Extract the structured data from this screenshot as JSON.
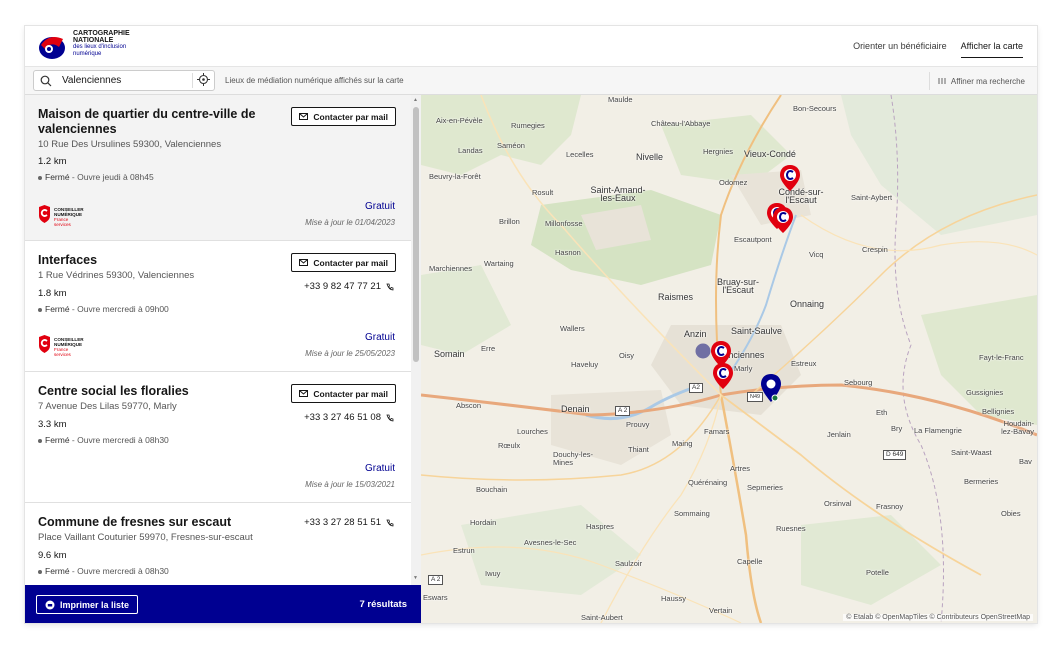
{
  "header": {
    "brand_line1": "CARTOGRAPHIE",
    "brand_line2": "NATIONALE",
    "brand_line3": "des lieux d'inclusion",
    "brand_line4": "numérique",
    "nav_orient": "Orienter un bénéficiaire",
    "nav_map": "Afficher la carte"
  },
  "search": {
    "value": "Valenciennes",
    "caption": "Lieux de médiation numérique affichés sur la carte",
    "refine_label": "Affiner ma recherche"
  },
  "cards": [
    {
      "title": "Maison de quartier du centre-ville de valenciennes",
      "address": "10 Rue Des Ursulines 59300, Valenciennes",
      "distance": "1.2 km",
      "status_closed": "Fermé",
      "status_detail": " - Ouvre jeudi à 08h45",
      "mail_label": "Contacter par mail",
      "price": "Gratuit",
      "updated": "Mise à jour le 01/04/2023"
    },
    {
      "title": "Interfaces",
      "address": "1 Rue Védrines 59300, Valenciennes",
      "distance": "1.8 km",
      "status_closed": "Fermé",
      "status_detail": " - Ouvre mercredi à 09h00",
      "mail_label": "Contacter par mail",
      "phone": "+33 9 82 47 77 21",
      "price": "Gratuit",
      "updated": "Mise à jour le 25/05/2023"
    },
    {
      "title": "Centre social les floralies",
      "address": "7 Avenue Des Lilas 59770, Marly",
      "distance": "3.3 km",
      "status_closed": "Fermé",
      "status_detail": " - Ouvre mercredi à 08h30",
      "mail_label": "Contacter par mail",
      "phone": "+33 3 27 46 51 08",
      "price": "Gratuit",
      "updated": "Mise à jour le 15/03/2021"
    },
    {
      "title": "Commune de fresnes sur escaut",
      "address": "Place Vaillant Couturier 59970, Fresnes-sur-escaut",
      "distance": "9.6 km",
      "status_closed": "Fermé",
      "status_detail": " - Ouvre mercredi à 08h30",
      "phone": "+33 3 27 28 51 51"
    }
  ],
  "conseiller_logo": {
    "line1": "CONSEILLER",
    "line2": "NUMÉRIQUE",
    "line3": "France",
    "line4": "services"
  },
  "footer": {
    "print_label": "Imprimer la liste",
    "results": "7 résultats"
  },
  "map": {
    "places": [
      "Maulde",
      "Bon-Secours",
      "Aix-en-Pévèle",
      "Rumegies",
      "Château-l'Abbaye",
      "Landas",
      "Saméon",
      "Lecelles",
      "Nivelle",
      "Hergnies",
      "Vieux-Condé",
      "Beuvry-la-Forêt",
      "Rosult",
      "Saint-Amand-les-Eaux",
      "Odomez",
      "Condé-sur-l'Escaut",
      "Saint-Aybert",
      "Brillon",
      "Millonfosse",
      "Escautpont",
      "Vicq",
      "Crespin",
      "Hasnon",
      "Marchiennes",
      "Wartaing",
      "Bruay-sur-l'Escaut",
      "Raismes",
      "Onnaing",
      "Wallers",
      "Anzin",
      "Saint-Saulve",
      "Somain",
      "Erre",
      "Oisy",
      "Haveluy",
      "Valenciennes",
      "Marly",
      "Estreux",
      "Sebourg",
      "Fayt-le-Franc",
      "Abscon",
      "Denain",
      "Prouvy",
      "Famars",
      "Eth",
      "Gussignies",
      "Bellignies",
      "Lourches",
      "Rœulx",
      "Thiant",
      "Maing",
      "Jenlain",
      "Bry",
      "La Flamengrie",
      "Houdain-lez-Bavay",
      "Saint-Waast",
      "Douchy-les-Mines",
      "Artres",
      "Bav",
      "Bouchain",
      "Quérénaing",
      "Sepmeries",
      "Bermeries",
      "Orsinval",
      "Frasnoy",
      "Hordain",
      "Sommaing",
      "Obies",
      "Haspres",
      "Ruesnes",
      "Avesnes-le-Sec",
      "Estrun",
      "Saulzoir",
      "Capelle",
      "Iwuy",
      "Potelle",
      "Eswars",
      "Haussy",
      "Vertain",
      "Saint-Aubert"
    ],
    "road_a2": "A2",
    "road_a2b": "A 2",
    "road_a2c": "A 2",
    "road_n49": "N49",
    "road_d649": "D 649",
    "road_a2d": "A 2",
    "attribution": "© Etalab © OpenMapTiles © Contributeurs OpenStreetMap"
  },
  "colors": {
    "brand_blue": "#000091",
    "marker_red": "#e1000f",
    "marker_blue": "#000091"
  }
}
